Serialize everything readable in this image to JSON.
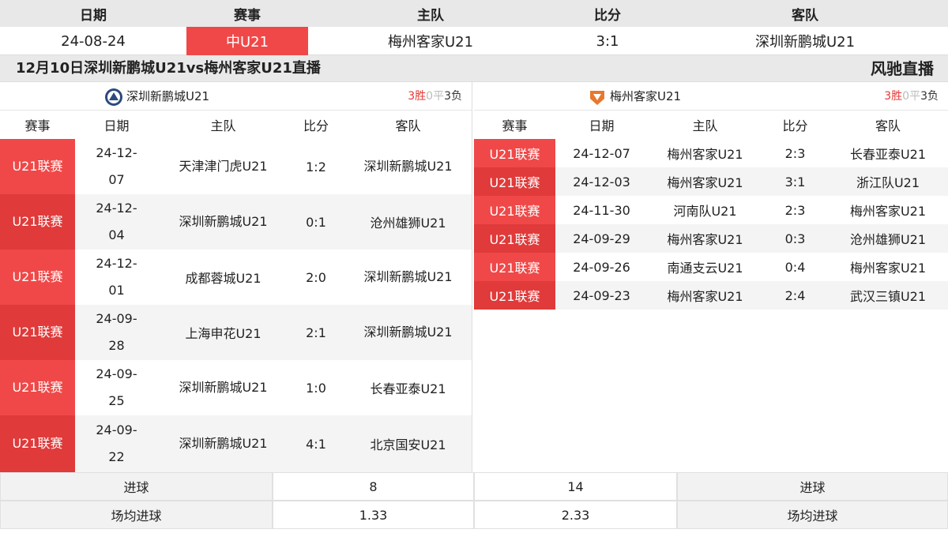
{
  "top": {
    "headers": [
      "日期",
      "赛事",
      "主队",
      "比分",
      "客队"
    ],
    "match": {
      "date": "24-08-24",
      "competition": "中U21",
      "home": "梅州客家U21",
      "score": "3:1",
      "away": "深圳新鹏城U21"
    }
  },
  "banner": {
    "title": "12月10日深圳新鹏城U21vs梅州客家U21直播",
    "brand": "风驰直播"
  },
  "left": {
    "team": "深圳新鹏城U21",
    "record": {
      "wins": "3胜",
      "draws": "0平",
      "losses": "3负"
    },
    "headers": [
      "赛事",
      "日期",
      "主队",
      "比分",
      "客队"
    ],
    "rows": [
      {
        "comp": "U21联赛",
        "date": "24-12-07",
        "home": "天津津门虎U21",
        "score": "1:2",
        "away": "深圳新鹏城U21"
      },
      {
        "comp": "U21联赛",
        "date": "24-12-04",
        "home": "深圳新鹏城U21",
        "score": "0:1",
        "away": "沧州雄狮U21"
      },
      {
        "comp": "U21联赛",
        "date": "24-12-01",
        "home": "成都蓉城U21",
        "score": "2:0",
        "away": "深圳新鹏城U21"
      },
      {
        "comp": "U21联赛",
        "date": "24-09-28",
        "home": "上海申花U21",
        "score": "2:1",
        "away": "深圳新鹏城U21"
      },
      {
        "comp": "U21联赛",
        "date": "24-09-25",
        "home": "深圳新鹏城U21",
        "score": "1:0",
        "away": "长春亚泰U21"
      },
      {
        "comp": "U21联赛",
        "date": "24-09-22",
        "home": "深圳新鹏城U21",
        "score": "4:1",
        "away": "北京国安U21"
      }
    ]
  },
  "right": {
    "team": "梅州客家U21",
    "record": {
      "wins": "3胜",
      "draws": "0平",
      "losses": "3负"
    },
    "headers": [
      "赛事",
      "日期",
      "主队",
      "比分",
      "客队"
    ],
    "rows": [
      {
        "comp": "U21联赛",
        "date": "24-12-07",
        "home": "梅州客家U21",
        "score": "2:3",
        "away": "长春亚泰U21"
      },
      {
        "comp": "U21联赛",
        "date": "24-12-03",
        "home": "梅州客家U21",
        "score": "3:1",
        "away": "浙江队U21"
      },
      {
        "comp": "U21联赛",
        "date": "24-11-30",
        "home": "河南队U21",
        "score": "2:3",
        "away": "梅州客家U21"
      },
      {
        "comp": "U21联赛",
        "date": "24-09-29",
        "home": "梅州客家U21",
        "score": "0:3",
        "away": "沧州雄狮U21"
      },
      {
        "comp": "U21联赛",
        "date": "24-09-26",
        "home": "南通支云U21",
        "score": "0:4",
        "away": "梅州客家U21"
      },
      {
        "comp": "U21联赛",
        "date": "24-09-23",
        "home": "梅州客家U21",
        "score": "2:4",
        "away": "武汉三镇U21"
      }
    ]
  },
  "stats": {
    "goals_label": "进球",
    "left_goals": "8",
    "right_goals": "14",
    "avg_label": "场均进球",
    "left_avg": "1.33",
    "right_avg": "2.33"
  },
  "colors": {
    "accent": "#f04848",
    "accent_dark": "#e03a3a",
    "win": "#e53935"
  }
}
